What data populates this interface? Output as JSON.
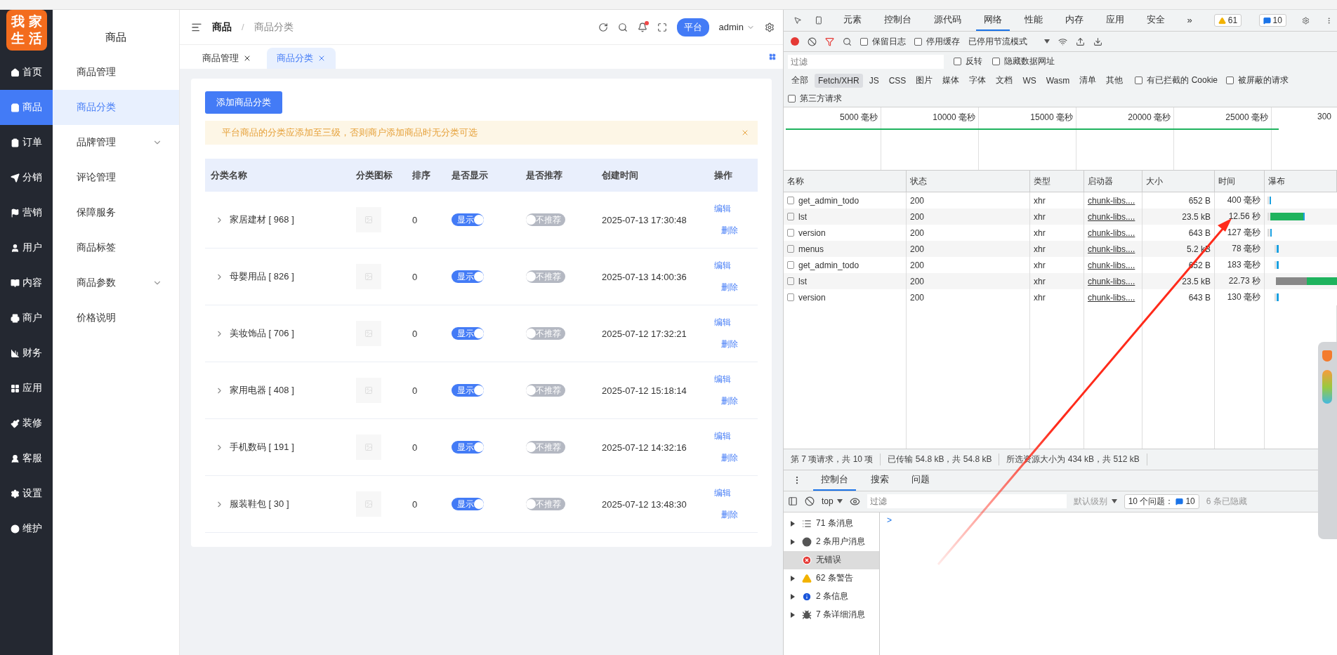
{
  "logo": {
    "lines": [
      "我家",
      "生活"
    ]
  },
  "main_nav": [
    {
      "label": "首页",
      "selected": false
    },
    {
      "label": "商品",
      "selected": true
    },
    {
      "label": "订单",
      "selected": false
    },
    {
      "label": "分销",
      "selected": false
    },
    {
      "label": "营销",
      "selected": false
    },
    {
      "label": "用户",
      "selected": false
    },
    {
      "label": "内容",
      "selected": false
    },
    {
      "label": "商户",
      "selected": false
    },
    {
      "label": "财务",
      "selected": false
    },
    {
      "label": "应用",
      "selected": false
    },
    {
      "label": "装修",
      "selected": false
    },
    {
      "label": "客服",
      "selected": false
    },
    {
      "label": "设置",
      "selected": false
    },
    {
      "label": "维护",
      "selected": false
    }
  ],
  "sub_nav": {
    "title": "商品",
    "items": [
      {
        "label": "商品管理",
        "selected": false,
        "expandable": false
      },
      {
        "label": "商品分类",
        "selected": true,
        "expandable": false
      },
      {
        "label": "品牌管理",
        "selected": false,
        "expandable": true
      },
      {
        "label": "评论管理",
        "selected": false,
        "expandable": false
      },
      {
        "label": "保障服务",
        "selected": false,
        "expandable": false
      },
      {
        "label": "商品标签",
        "selected": false,
        "expandable": false
      },
      {
        "label": "商品参数",
        "selected": false,
        "expandable": true
      },
      {
        "label": "价格说明",
        "selected": false,
        "expandable": false
      }
    ]
  },
  "header": {
    "breadcrumb": [
      "商品",
      "商品分类"
    ],
    "breadcrumb_separator": "/",
    "role_badge": "平台",
    "user": "admin"
  },
  "tabs": [
    {
      "label": "商品管理",
      "selected": false
    },
    {
      "label": "商品分类",
      "selected": true
    }
  ],
  "add_button": "添加商品分类",
  "alert": "平台商品的分类应添加至三级，否则商户添加商品时无分类可选",
  "table": {
    "columns": [
      "分类名称",
      "分类图标",
      "排序",
      "是否显示",
      "是否推荐",
      "创建时间",
      "操作"
    ],
    "rows": [
      {
        "name": "家居建材 [ 968 ]",
        "sort": "0",
        "show": {
          "on": true,
          "label": "显示"
        },
        "recommend": {
          "on": false,
          "label": "不推荐"
        },
        "created": "2025-07-13 17:30:48",
        "actions": [
          "编辑",
          "删除"
        ]
      },
      {
        "name": "母婴用品 [ 826 ]",
        "sort": "0",
        "show": {
          "on": true,
          "label": "显示"
        },
        "recommend": {
          "on": false,
          "label": "不推荐"
        },
        "created": "2025-07-13 14:00:36",
        "actions": [
          "编辑",
          "删除"
        ]
      },
      {
        "name": "美妆饰品 [ 706 ]",
        "sort": "0",
        "show": {
          "on": true,
          "label": "显示"
        },
        "recommend": {
          "on": false,
          "label": "不推荐"
        },
        "created": "2025-07-12 17:32:21",
        "actions": [
          "编辑",
          "删除"
        ]
      },
      {
        "name": "家用电器 [ 408 ]",
        "sort": "0",
        "show": {
          "on": true,
          "label": "显示"
        },
        "recommend": {
          "on": false,
          "label": "不推荐"
        },
        "created": "2025-07-12 15:18:14",
        "actions": [
          "编辑",
          "删除"
        ]
      },
      {
        "name": "手机数码 [ 191 ]",
        "sort": "0",
        "show": {
          "on": true,
          "label": "显示"
        },
        "recommend": {
          "on": false,
          "label": "不推荐"
        },
        "created": "2025-07-12 14:32:16",
        "actions": [
          "编辑",
          "删除"
        ]
      },
      {
        "name": "服装鞋包 [ 30 ]",
        "sort": "0",
        "show": {
          "on": true,
          "label": "显示"
        },
        "recommend": {
          "on": false,
          "label": "不推荐"
        },
        "created": "2025-07-12 13:48:30",
        "actions": [
          "编辑",
          "删除"
        ]
      }
    ]
  },
  "devtools": {
    "tabs": [
      {
        "label": "元素",
        "selected": false
      },
      {
        "label": "控制台",
        "selected": false
      },
      {
        "label": "源代码",
        "selected": false
      },
      {
        "label": "网络",
        "selected": true
      },
      {
        "label": "性能",
        "selected": false
      },
      {
        "label": "内存",
        "selected": false
      },
      {
        "label": "应用",
        "selected": false
      },
      {
        "label": "安全",
        "selected": false
      }
    ],
    "more": "»",
    "warnings": "61",
    "messages": "10",
    "toolbar": {
      "options": [
        {
          "label": "保留日志",
          "checked": false
        },
        {
          "label": "停用缓存",
          "checked": false
        }
      ],
      "throttle": "已停用节流模式"
    },
    "filter": {
      "placeholder": "过滤",
      "options": [
        {
          "label": "反转",
          "checked": false
        },
        {
          "label": "隐藏数据网址",
          "checked": false
        }
      ]
    },
    "types": [
      {
        "label": "全部",
        "selected": false
      },
      {
        "label": "Fetch/XHR",
        "selected": true
      },
      {
        "label": "JS",
        "selected": false
      },
      {
        "label": "CSS",
        "selected": false
      },
      {
        "label": "图片",
        "selected": false
      },
      {
        "label": "媒体",
        "selected": false
      },
      {
        "label": "字体",
        "selected": false
      },
      {
        "label": "文档",
        "selected": false
      },
      {
        "label": "WS",
        "selected": false
      },
      {
        "label": "Wasm",
        "selected": false
      },
      {
        "label": "清单",
        "selected": false
      },
      {
        "label": "其他",
        "selected": false
      }
    ],
    "type_options": [
      {
        "label": "有已拦截的 Cookie",
        "checked": false
      },
      {
        "label": "被屏蔽的请求",
        "checked": false
      }
    ],
    "third_party": {
      "label": "第三方请求",
      "checked": false
    },
    "timeline_ticks": [
      "5000 毫秒",
      "10000 毫秒",
      "15000 毫秒",
      "20000 毫秒",
      "25000 毫秒",
      "300"
    ],
    "columns": [
      "名称",
      "状态",
      "类型",
      "启动器",
      "大小",
      "时间",
      "瀑布"
    ],
    "requests": [
      {
        "name": "get_admin_todo",
        "status": "200",
        "type": "xhr",
        "initiator": "chunk-libs....",
        "size": "652 B",
        "time": "400 毫秒"
      },
      {
        "name": "lst",
        "status": "200",
        "type": "xhr",
        "initiator": "chunk-libs....",
        "size": "23.5 kB",
        "time": "12.56 秒"
      },
      {
        "name": "version",
        "status": "200",
        "type": "xhr",
        "initiator": "chunk-libs....",
        "size": "643 B",
        "time": "127 毫秒"
      },
      {
        "name": "menus",
        "status": "200",
        "type": "xhr",
        "initiator": "chunk-libs....",
        "size": "5.2 kB",
        "time": "78 毫秒"
      },
      {
        "name": "get_admin_todo",
        "status": "200",
        "type": "xhr",
        "initiator": "chunk-libs....",
        "size": "652 B",
        "time": "183 毫秒"
      },
      {
        "name": "lst",
        "status": "200",
        "type": "xhr",
        "initiator": "chunk-libs....",
        "size": "23.5 kB",
        "time": "22.73 秒"
      },
      {
        "name": "version",
        "status": "200",
        "type": "xhr",
        "initiator": "chunk-libs....",
        "size": "643 B",
        "time": "130 毫秒"
      }
    ],
    "summary": [
      "第 7 项请求，共 10 项",
      "已传输 54.8 kB，共 54.8 kB",
      "所选资源大小为 434 kB，共 512 kB"
    ],
    "drawer_tabs": [
      {
        "label": "控制台",
        "selected": true
      },
      {
        "label": "搜索",
        "selected": false
      },
      {
        "label": "问题",
        "selected": false
      }
    ],
    "console_toolbar": {
      "context": "top",
      "filter_placeholder": "过滤",
      "level": "默认级别",
      "issues": "10 个问题：",
      "issues_count": "10",
      "hidden": "6 条已隐藏"
    },
    "console_groups": [
      {
        "kind": "list",
        "label": "71 条消息",
        "selected": false
      },
      {
        "kind": "user",
        "label": "2 条用户消息",
        "selected": false
      },
      {
        "kind": "error",
        "label": "无错误",
        "selected": true
      },
      {
        "kind": "warning",
        "label": "62 条警告",
        "selected": false
      },
      {
        "kind": "info",
        "label": "2 条信息",
        "selected": false
      },
      {
        "kind": "verbose",
        "label": "7 条详细消息",
        "selected": false
      }
    ],
    "prompt": ">"
  }
}
